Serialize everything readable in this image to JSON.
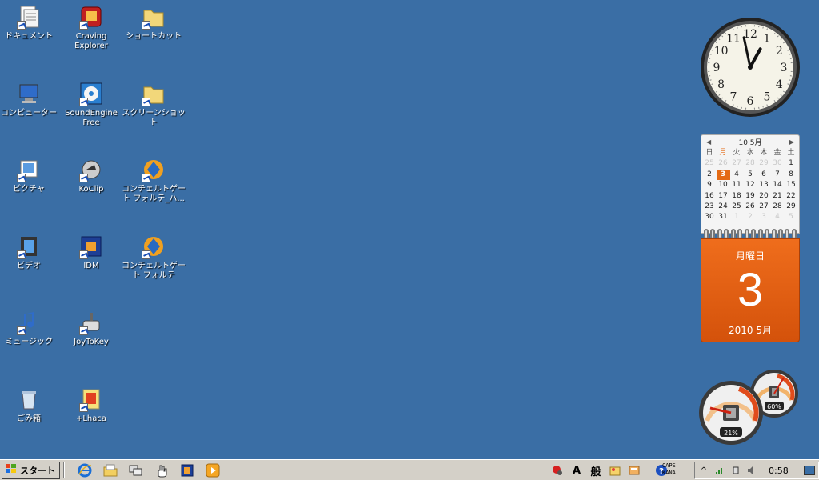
{
  "desktop": {
    "icons": [
      {
        "label": "ドキュメント",
        "icon": "documents-icon"
      },
      {
        "label": "Craving\nExplorer",
        "icon": "craving-explorer-icon"
      },
      {
        "label": "ショートカット",
        "icon": "folder-shortcut-icon"
      },
      {
        "label": "コンピューター",
        "icon": "computer-icon"
      },
      {
        "label": "SoundEngine\nFree",
        "icon": "soundengine-icon"
      },
      {
        "label": "スクリーンショット",
        "icon": "folder-screenshot-icon"
      },
      {
        "label": "ピクチャ",
        "icon": "pictures-icon"
      },
      {
        "label": "KoClip",
        "icon": "koclip-icon"
      },
      {
        "label": "コンチェルトゲート フォルテ_ハ...",
        "icon": "concerto-gate-icon"
      },
      {
        "label": "ビデオ",
        "icon": "videos-icon"
      },
      {
        "label": "IDM",
        "icon": "idm-icon"
      },
      {
        "label": "コンチェルトゲート フォルテ",
        "icon": "concerto-gate-forte-icon"
      },
      {
        "label": "ミュージック",
        "icon": "music-icon"
      },
      {
        "label": "JoyToKey",
        "icon": "joytokey-icon"
      },
      {
        "label": "ごみ箱",
        "icon": "recycle-bin-icon"
      },
      {
        "label": "+Lhaca",
        "icon": "lhaca-icon"
      }
    ]
  },
  "clock": {
    "hour": 0,
    "minute": 58,
    "numbers": [
      "12",
      "1",
      "2",
      "3",
      "4",
      "5",
      "6",
      "7",
      "8",
      "9",
      "10",
      "11"
    ]
  },
  "calendar": {
    "header": "10 5月",
    "prev": "◀",
    "next": "▶",
    "weekdays": [
      "日",
      "月",
      "火",
      "水",
      "木",
      "金",
      "土"
    ],
    "weeks": [
      [
        "25",
        "26",
        "27",
        "28",
        "29",
        "30",
        "1"
      ],
      [
        "2",
        "3",
        "4",
        "5",
        "6",
        "7",
        "8"
      ],
      [
        "9",
        "10",
        "11",
        "12",
        "13",
        "14",
        "15"
      ],
      [
        "16",
        "17",
        "18",
        "19",
        "20",
        "21",
        "22"
      ],
      [
        "23",
        "24",
        "25",
        "26",
        "27",
        "28",
        "29"
      ],
      [
        "30",
        "31",
        "1",
        "2",
        "3",
        "4",
        "5"
      ]
    ],
    "today": "3",
    "weekday_label": "月曜日",
    "day_number": "3",
    "year_month": "2010 5月"
  },
  "meter": {
    "cpu": "21%",
    "memory": "60%",
    "cpu_value": 21,
    "memory_value": 60
  },
  "taskbar": {
    "start_label": "スタート",
    "quick_launch": [
      "ie-icon",
      "explorer-folder-icon",
      "switch-windows-icon",
      "hand-tool-icon",
      "app-tile-icon",
      "media-play-icon"
    ],
    "lang": {
      "mode": "A",
      "ime": "般"
    },
    "caps": "CAPS",
    "kana": "KANA",
    "time": "0:58"
  }
}
